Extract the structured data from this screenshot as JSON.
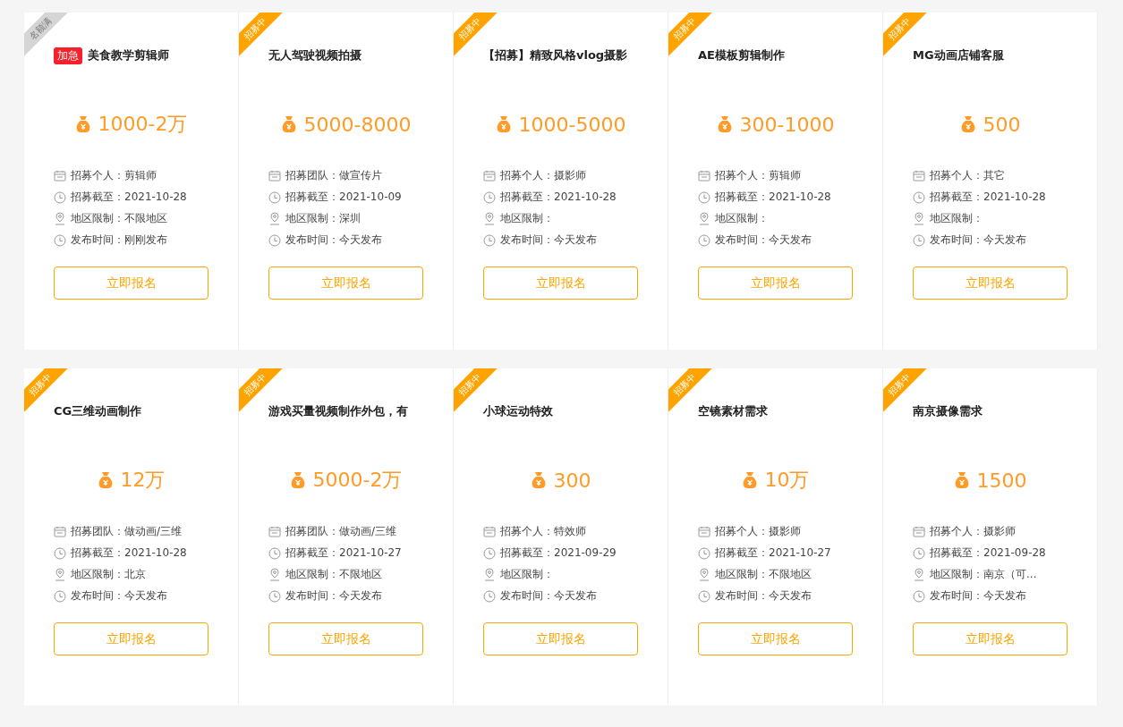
{
  "cards": [
    {
      "ribbon": {
        "text": "名额满",
        "kind": "full"
      },
      "urgent_badge": "加急",
      "title": "美食教学剪辑师",
      "price": "1000-2万",
      "details": [
        {
          "kind": "calendar",
          "label": "招募个人：",
          "value": "剪辑师"
        },
        {
          "kind": "clock",
          "label": "招募截至：",
          "value": "2021-10-28"
        },
        {
          "kind": "pin",
          "label": "地区限制：",
          "value": "不限地区"
        },
        {
          "kind": "clock",
          "label": "发布时间：",
          "value": "刚刚发布"
        }
      ],
      "button": "立即报名"
    },
    {
      "ribbon": {
        "text": "招募中",
        "kind": "open"
      },
      "title": "无人驾驶视频拍摄",
      "price": "5000-8000",
      "details": [
        {
          "kind": "calendar",
          "label": "招募团队：",
          "value": "做宣传片"
        },
        {
          "kind": "clock",
          "label": "招募截至：",
          "value": "2021-10-09"
        },
        {
          "kind": "pin",
          "label": "地区限制：",
          "value": "深圳"
        },
        {
          "kind": "clock",
          "label": "发布时间：",
          "value": "今天发布"
        }
      ],
      "button": "立即报名"
    },
    {
      "ribbon": {
        "text": "招募中",
        "kind": "open"
      },
      "title": "【招募】精致风格vlog摄影",
      "price": "1000-5000",
      "details": [
        {
          "kind": "calendar",
          "label": "招募个人：",
          "value": "摄影师"
        },
        {
          "kind": "clock",
          "label": "招募截至：",
          "value": "2021-10-28"
        },
        {
          "kind": "pin",
          "label": "地区限制："
        },
        {
          "kind": "clock",
          "label": "发布时间：",
          "value": "今天发布"
        }
      ],
      "button": "立即报名"
    },
    {
      "ribbon": {
        "text": "招募中",
        "kind": "open"
      },
      "title": "AE模板剪辑制作",
      "price": "300-1000",
      "details": [
        {
          "kind": "calendar",
          "label": "招募个人：",
          "value": "剪辑师"
        },
        {
          "kind": "clock",
          "label": "招募截至：",
          "value": "2021-10-28"
        },
        {
          "kind": "pin",
          "label": "地区限制："
        },
        {
          "kind": "clock",
          "label": "发布时间：",
          "value": "今天发布"
        }
      ],
      "button": "立即报名"
    },
    {
      "ribbon": {
        "text": "招募中",
        "kind": "open"
      },
      "title": "MG动画店铺客服",
      "price": "500",
      "details": [
        {
          "kind": "calendar",
          "label": "招募个人：",
          "value": "其它"
        },
        {
          "kind": "clock",
          "label": "招募截至：",
          "value": "2021-10-28"
        },
        {
          "kind": "pin",
          "label": "地区限制："
        },
        {
          "kind": "clock",
          "label": "发布时间：",
          "value": "今天发布"
        }
      ],
      "button": "立即报名"
    },
    {
      "ribbon": {
        "text": "招募中",
        "kind": "open"
      },
      "title": "CG三维动画制作",
      "price": "12万",
      "details": [
        {
          "kind": "calendar",
          "label": "招募团队：",
          "value": "做动画/三维"
        },
        {
          "kind": "clock",
          "label": "招募截至：",
          "value": "2021-10-28"
        },
        {
          "kind": "pin",
          "label": "地区限制：",
          "value": "北京"
        },
        {
          "kind": "clock",
          "label": "发布时间：",
          "value": "今天发布"
        }
      ],
      "button": "立即报名"
    },
    {
      "ribbon": {
        "text": "招募中",
        "kind": "open"
      },
      "title": "游戏买量视频制作外包，有",
      "price": "5000-2万",
      "details": [
        {
          "kind": "calendar",
          "label": "招募团队：",
          "value": "做动画/三维"
        },
        {
          "kind": "clock",
          "label": "招募截至：",
          "value": "2021-10-27"
        },
        {
          "kind": "pin",
          "label": "地区限制：",
          "value": "不限地区"
        },
        {
          "kind": "clock",
          "label": "发布时间：",
          "value": "今天发布"
        }
      ],
      "button": "立即报名"
    },
    {
      "ribbon": {
        "text": "招募中",
        "kind": "open"
      },
      "title": "小球运动特效",
      "price": "300",
      "details": [
        {
          "kind": "calendar",
          "label": "招募个人：",
          "value": "特效师"
        },
        {
          "kind": "clock",
          "label": "招募截至：",
          "value": "2021-09-29"
        },
        {
          "kind": "pin",
          "label": "地区限制："
        },
        {
          "kind": "clock",
          "label": "发布时间：",
          "value": "今天发布"
        }
      ],
      "button": "立即报名"
    },
    {
      "ribbon": {
        "text": "招募中",
        "kind": "open"
      },
      "title": "空镜素材需求",
      "price": "10万",
      "details": [
        {
          "kind": "calendar",
          "label": "招募个人：",
          "value": "摄影师"
        },
        {
          "kind": "clock",
          "label": "招募截至：",
          "value": "2021-10-27"
        },
        {
          "kind": "pin",
          "label": "地区限制：",
          "value": "不限地区"
        },
        {
          "kind": "clock",
          "label": "发布时间：",
          "value": "今天发布"
        }
      ],
      "button": "立即报名"
    },
    {
      "ribbon": {
        "text": "招募中",
        "kind": "open"
      },
      "title": "南京摄像需求",
      "price": "1500",
      "details": [
        {
          "kind": "calendar",
          "label": "招募个人：",
          "value": "摄影师"
        },
        {
          "kind": "clock",
          "label": "招募截至：",
          "value": "2021-09-28"
        },
        {
          "kind": "pin",
          "label": "地区限制：",
          "value": "南京（可..."
        },
        {
          "kind": "clock",
          "label": "发布时间：",
          "value": "今天发布"
        }
      ],
      "button": "立即报名"
    }
  ]
}
